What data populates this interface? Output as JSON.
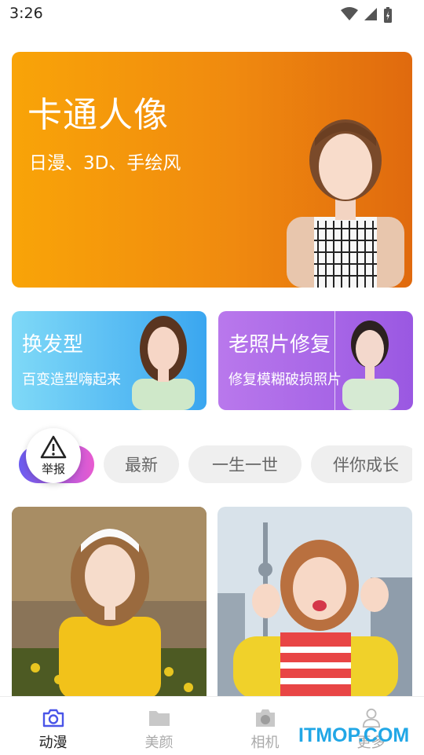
{
  "status_bar": {
    "time": "3:26"
  },
  "hero": {
    "title": "卡通人像",
    "subtitle": "日漫、3D、手绘风"
  },
  "cards": [
    {
      "title": "换发型",
      "subtitle": "百变造型嗨起来"
    },
    {
      "title": "老照片修复",
      "subtitle": "修复模糊破损照片"
    }
  ],
  "report": {
    "label": "举报"
  },
  "tags": [
    "最新",
    "一生一世",
    "伴你成长"
  ],
  "tabs": [
    {
      "label": "动漫",
      "icon": "camera-icon",
      "active": true
    },
    {
      "label": "美颜",
      "icon": "folder-icon",
      "active": false
    },
    {
      "label": "相机",
      "icon": "camera-icon",
      "active": false
    },
    {
      "label": "更多",
      "icon": "person-icon",
      "active": false
    }
  ],
  "watermark": "ITMOP.COM",
  "colors": {
    "accent": "#4a55e8",
    "hero_orange": "#f39a0c",
    "card_blue": "#3aa6f0",
    "card_purple": "#a062e6"
  }
}
